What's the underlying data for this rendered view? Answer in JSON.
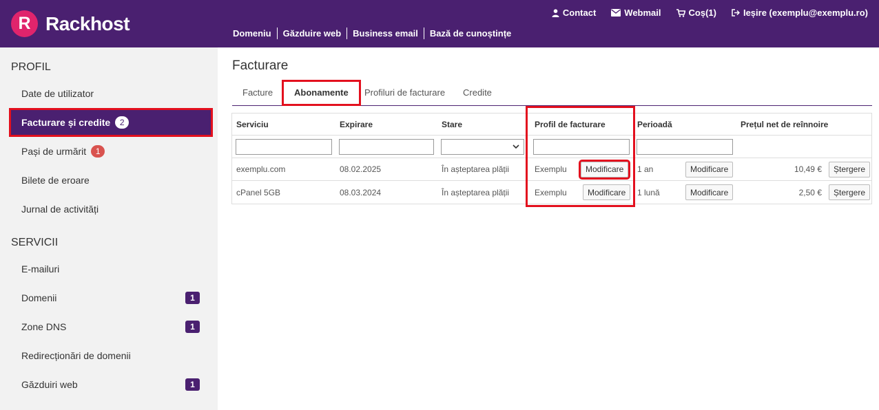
{
  "brand": {
    "letter": "R",
    "name": "Rackhost",
    "accent": "#e0246c",
    "primary": "#4a2070",
    "highlight": "#e3101e"
  },
  "topnav": [
    {
      "icon": "user-icon",
      "label": "Contact"
    },
    {
      "icon": "envelope-icon",
      "label": "Webmail"
    },
    {
      "icon": "cart-icon",
      "label": "Coș(1)"
    },
    {
      "icon": "sign-out-icon",
      "label": "Ieșire (exemplu@exemplu.ro)"
    }
  ],
  "mainnav": [
    "Domeniu",
    "Găzduire web",
    "Business email",
    "Bază de cunoștințe"
  ],
  "sidebar": {
    "profile_heading": "PROFIL",
    "profile_items": [
      {
        "label": "Date de utilizator"
      },
      {
        "label": "Facturare și credite",
        "badge": "2"
      },
      {
        "label": "Pași de urmărit",
        "badge": "1"
      },
      {
        "label": "Bilete de eroare"
      },
      {
        "label": "Jurnal de activități"
      }
    ],
    "services_heading": "SERVICII",
    "service_items": [
      {
        "label": "E-mailuri"
      },
      {
        "label": "Domenii",
        "badge": "1"
      },
      {
        "label": "Zone DNS",
        "badge": "1"
      },
      {
        "label": "Redirecționări de domenii"
      },
      {
        "label": "Găzduiri web",
        "badge": "1"
      }
    ]
  },
  "page_title": "Facturare",
  "tabs": [
    "Facture",
    "Abonamente",
    "Profiluri de facturare",
    "Credite"
  ],
  "table": {
    "headers": [
      "Serviciu",
      "Expirare",
      "Stare",
      "Profil de facturare",
      "Perioadă",
      "Prețul net de reînnoire"
    ],
    "rows": [
      {
        "service": "exemplu.com",
        "expiry": "08.02.2025",
        "status": "În așteptarea plății",
        "profile": "Exemplu",
        "period": "1 an",
        "price": "10,49 €"
      },
      {
        "service": "cPanel 5GB",
        "expiry": "08.03.2024",
        "status": "În așteptarea plății",
        "profile": "Exemplu",
        "period": "1 lună",
        "price": "2,50 €"
      }
    ],
    "modify_label": "Modificare",
    "delete_label": "Ștergere"
  }
}
